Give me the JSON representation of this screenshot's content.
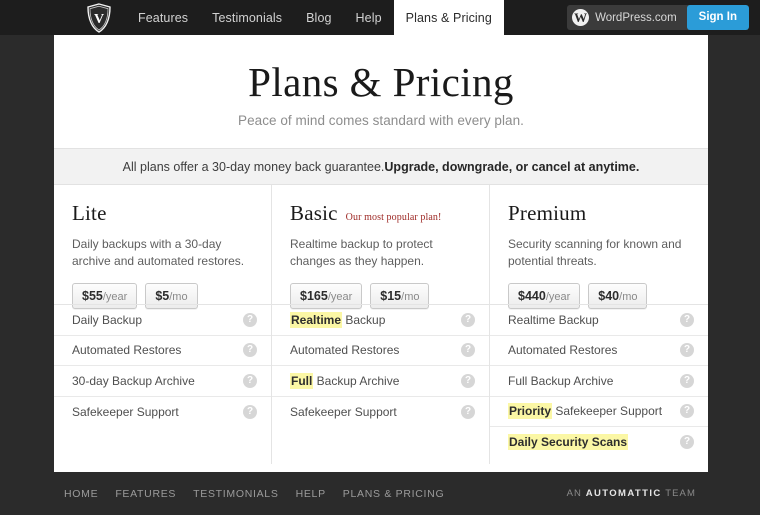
{
  "topnav": {
    "logo_alt": "VaultPress shield logo",
    "items": [
      {
        "label": "Features",
        "active": false
      },
      {
        "label": "Testimonials",
        "active": false
      },
      {
        "label": "Blog",
        "active": false
      },
      {
        "label": "Help",
        "active": false
      },
      {
        "label": "Plans & Pricing",
        "active": true
      }
    ],
    "wordpress_label": "WordPress.com",
    "wordpress_mark": "W",
    "signin_label": "Sign In",
    "signin_color": "#2b9cd8"
  },
  "hero": {
    "title": "Plans & Pricing",
    "subtitle": "Peace of mind comes standard with every plan."
  },
  "guarantee": {
    "lead": "All plans offer a 30-day money back guarantee. ",
    "strong": "Upgrade, downgrade, or cancel at anytime."
  },
  "plans": [
    {
      "name": "Lite",
      "badge": "",
      "description": "Daily backups with a 30-day archive and automated restores.",
      "prices": [
        {
          "amount": "$55",
          "period": "/year"
        },
        {
          "amount": "$5",
          "period": "/mo"
        }
      ],
      "features": [
        {
          "highlight": "",
          "text": "Daily Backup",
          "help": "?"
        },
        {
          "highlight": "",
          "text": "Automated Restores",
          "help": "?"
        },
        {
          "highlight": "",
          "text": "30-day Backup Archive",
          "help": "?"
        },
        {
          "highlight": "",
          "text": "Safekeeper Support",
          "help": "?"
        }
      ]
    },
    {
      "name": "Basic",
      "badge": "Our most popular plan!",
      "description": "Realtime backup to protect changes as they happen.",
      "prices": [
        {
          "amount": "$165",
          "period": "/year"
        },
        {
          "amount": "$15",
          "period": "/mo"
        }
      ],
      "features": [
        {
          "highlight": "Realtime",
          "text": " Backup",
          "help": "?"
        },
        {
          "highlight": "",
          "text": "Automated Restores",
          "help": "?"
        },
        {
          "highlight": "Full",
          "text": " Backup Archive",
          "help": "?"
        },
        {
          "highlight": "",
          "text": "Safekeeper Support",
          "help": "?"
        }
      ]
    },
    {
      "name": "Premium",
      "badge": "",
      "description": "Security scanning for known and potential threats.",
      "prices": [
        {
          "amount": "$440",
          "period": "/year"
        },
        {
          "amount": "$40",
          "period": "/mo"
        }
      ],
      "features": [
        {
          "highlight": "",
          "text": "Realtime Backup",
          "help": "?"
        },
        {
          "highlight": "",
          "text": "Automated Restores",
          "help": "?"
        },
        {
          "highlight": "",
          "text": "Full Backup Archive",
          "help": "?"
        },
        {
          "highlight": "Priority",
          "text": " Safekeeper Support",
          "help": "?"
        },
        {
          "highlight": "Daily Security Scans",
          "text": "",
          "help": "?"
        }
      ]
    }
  ],
  "footer": {
    "links": [
      "HOME",
      "FEATURES",
      "TESTIMONIALS",
      "HELP",
      "PLANS & PRICING"
    ],
    "credit_pre": "AN ",
    "credit_brand": "AUTOMATTIC",
    "credit_post": " TEAM"
  },
  "theme": {
    "chrome_bg": "#2b2b2b",
    "nav_bg": "#1d1d1d",
    "card_bg": "#ffffff",
    "highlight": "#fbf7a5",
    "badge_red": "#9e2a26"
  }
}
